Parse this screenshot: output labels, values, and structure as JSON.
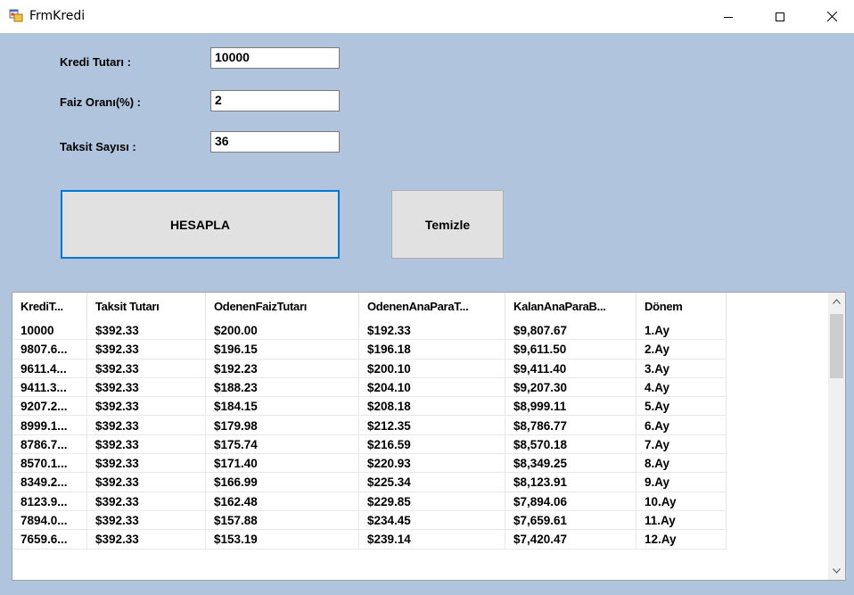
{
  "window": {
    "title": "FrmKredi"
  },
  "form": {
    "kredi_label": "Kredi Tutarı :",
    "kredi_value": "10000",
    "faiz_label": "Faiz Oranı(%) :",
    "faiz_value": "2",
    "taksit_label": "Taksit Sayısı :",
    "taksit_value": "36",
    "hesapla_label": "HESAPLA",
    "temizle_label": "Temizle"
  },
  "grid": {
    "columns": [
      "KrediT...",
      "Taksit Tutarı",
      "OdenenFaizTutarı",
      "OdenenAnaParaT...",
      "KalanAnaParaB...",
      "Dönem"
    ],
    "rows": [
      [
        "10000",
        "$392.33",
        "$200.00",
        "$192.33",
        "$9,807.67",
        "1.Ay"
      ],
      [
        "9807.6...",
        "$392.33",
        "$196.15",
        "$196.18",
        "$9,611.50",
        "2.Ay"
      ],
      [
        "9611.4...",
        "$392.33",
        "$192.23",
        "$200.10",
        "$9,411.40",
        "3.Ay"
      ],
      [
        "9411.3...",
        "$392.33",
        "$188.23",
        "$204.10",
        "$9,207.30",
        "4.Ay"
      ],
      [
        "9207.2...",
        "$392.33",
        "$184.15",
        "$208.18",
        "$8,999.11",
        "5.Ay"
      ],
      [
        "8999.1...",
        "$392.33",
        "$179.98",
        "$212.35",
        "$8,786.77",
        "6.Ay"
      ],
      [
        "8786.7...",
        "$392.33",
        "$175.74",
        "$216.59",
        "$8,570.18",
        "7.Ay"
      ],
      [
        "8570.1...",
        "$392.33",
        "$171.40",
        "$220.93",
        "$8,349.25",
        "8.Ay"
      ],
      [
        "8349.2...",
        "$392.33",
        "$166.99",
        "$225.34",
        "$8,123.91",
        "9.Ay"
      ],
      [
        "8123.9...",
        "$392.33",
        "$162.48",
        "$229.85",
        "$7,894.06",
        "10.Ay"
      ],
      [
        "7894.0...",
        "$392.33",
        "$157.88",
        "$234.45",
        "$7,659.61",
        "11.Ay"
      ],
      [
        "7659.6...",
        "$392.33",
        "$153.19",
        "$239.14",
        "$7,420.47",
        "12.Ay"
      ]
    ]
  }
}
